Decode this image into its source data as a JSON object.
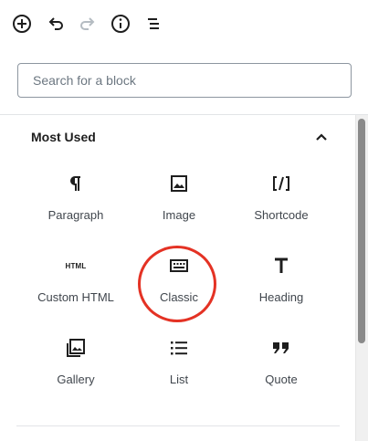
{
  "search": {
    "placeholder": "Search for a block"
  },
  "panel": {
    "title": "Most Used",
    "expanded": true
  },
  "toolbar": {
    "icons": [
      "add-block-icon",
      "undo-icon",
      "redo-icon",
      "info-icon",
      "block-navigation-icon"
    ],
    "redo_disabled": true
  },
  "blocks": [
    {
      "label": "Paragraph",
      "icon": "paragraph-icon"
    },
    {
      "label": "Image",
      "icon": "image-icon"
    },
    {
      "label": "Shortcode",
      "icon": "shortcode-icon"
    },
    {
      "label": "Custom HTML",
      "icon": "html-icon",
      "icon_text": "HTML"
    },
    {
      "label": "Classic",
      "icon": "keyboard-icon"
    },
    {
      "label": "Heading",
      "icon": "heading-icon"
    },
    {
      "label": "Gallery",
      "icon": "gallery-icon"
    },
    {
      "label": "List",
      "icon": "list-icon"
    },
    {
      "label": "Quote",
      "icon": "quote-icon"
    }
  ],
  "colors": {
    "text": "#1e1e1e",
    "label": "#40464d",
    "highlight": "#e43224",
    "disabled": "#b5bcc2"
  }
}
